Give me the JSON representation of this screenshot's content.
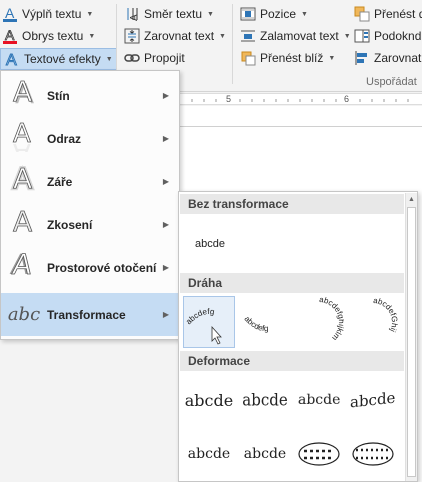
{
  "ribbon": {
    "fill_text": "Výplň textu",
    "outline_text": "Obrys textu",
    "text_effects": "Textové efekty",
    "text_direction": "Směr textu",
    "align_text": "Zarovnat text",
    "link": "Propojit",
    "position": "Pozice",
    "wrap_text": "Zalamovat text",
    "bring_forward": "Přenést blíž",
    "bring_front": "Přenést d",
    "align_under": "Podoknd",
    "align": "Zarovnat",
    "group_arrange": "Uspořádat",
    "group_partial": "t",
    "colors": {
      "fill_accent": "#2e75b6",
      "outline_accent": "#e81123"
    }
  },
  "ruler": {
    "marks": [
      "5",
      "6"
    ]
  },
  "menu": {
    "items": [
      {
        "label": "Stín",
        "icon": "shadow-A-icon"
      },
      {
        "label": "Odraz",
        "icon": "reflection-A-icon"
      },
      {
        "label": "Záře",
        "icon": "glow-A-icon"
      },
      {
        "label": "Zkosení",
        "icon": "bevel-A-icon"
      },
      {
        "label": "Prostorové otočení",
        "icon": "3d-rotation-A-icon"
      },
      {
        "label": "Transformace",
        "icon": "abc-transform-icon"
      }
    ],
    "active_index": 5,
    "transform_icon_text": "abc"
  },
  "gallery": {
    "sections": [
      {
        "title": "Bez transformace"
      },
      {
        "title": "Dráha"
      },
      {
        "title": "Deformace"
      }
    ],
    "no_transform_sample": "abcde",
    "path_samples": [
      "abcdefg",
      "abcdefg",
      "abcdefghijklm",
      "abcdefGhij"
    ],
    "warp_sample": "abcde"
  }
}
